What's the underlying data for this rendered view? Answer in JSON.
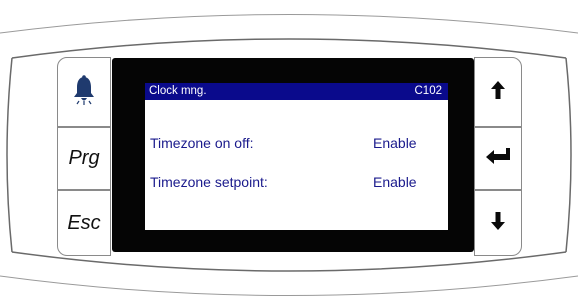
{
  "keys_left": [
    {
      "name": "alarm-key",
      "icon": "bell-icon",
      "label": ""
    },
    {
      "name": "prg-key",
      "label": "Prg"
    },
    {
      "name": "esc-key",
      "label": "Esc"
    }
  ],
  "keys_right": [
    {
      "name": "up-key",
      "icon": "arrow-up-icon"
    },
    {
      "name": "enter-key",
      "icon": "enter-icon"
    },
    {
      "name": "down-key",
      "icon": "arrow-down-icon"
    }
  ],
  "screen": {
    "title": "Clock mng.",
    "code": "C102",
    "rows": [
      {
        "label": "Timezone on off:",
        "value": "Enable"
      },
      {
        "label": "Timezone setpoint:",
        "value": "Enable"
      }
    ]
  },
  "colors": {
    "header_bg": "#0a0a8c",
    "text": "#1a1a8c",
    "bell": "#1f3a6e",
    "bezel": "#050505"
  }
}
